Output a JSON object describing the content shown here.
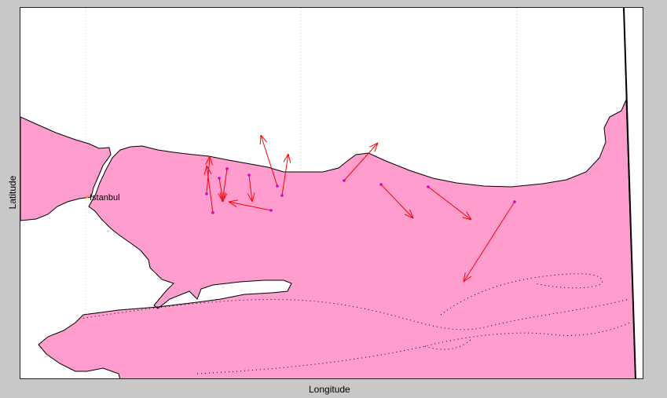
{
  "axes": {
    "xlabel": "Longitude",
    "ylabel": "Latitude"
  },
  "colors": {
    "land": "#ff9ece",
    "sea": "#ffffff",
    "vector": "#ff0000",
    "station": "#d000d0",
    "city": "#ff8c00",
    "coastline": "#000000",
    "grid": "#c0c0c0"
  },
  "map": {
    "grid": true,
    "cities": [
      {
        "name": "Istanbul"
      }
    ],
    "velocity_vectors_count": 13
  }
}
